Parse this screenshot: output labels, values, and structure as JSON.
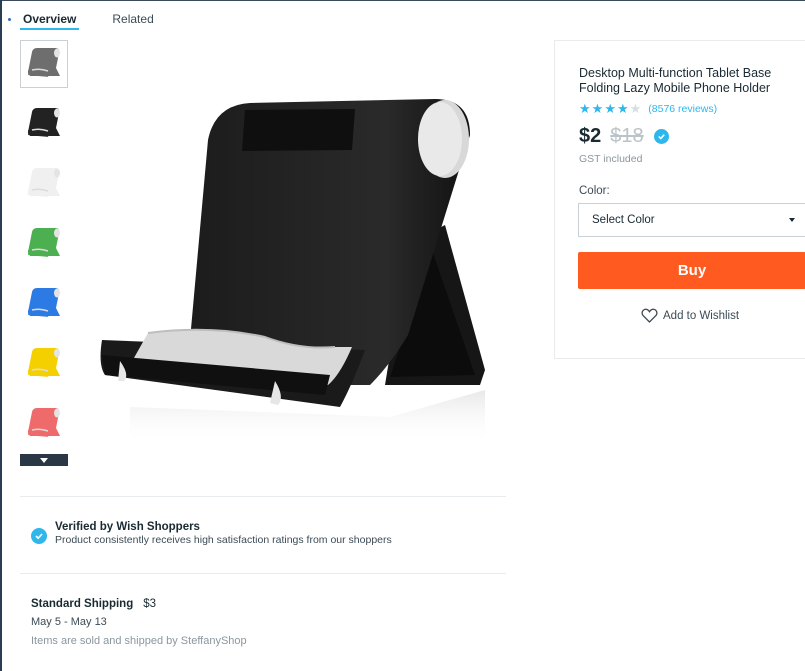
{
  "tabs": {
    "overview": "Overview",
    "related": "Related"
  },
  "thumbnails": [
    {
      "color": "#6e6e6e",
      "icon": "stand-gray-icon"
    },
    {
      "color": "#222222",
      "icon": "stand-black-icon"
    },
    {
      "color": "#f0f0f0",
      "icon": "stand-white-icon"
    },
    {
      "color": "#4caf50",
      "icon": "stand-green-icon"
    },
    {
      "color": "#2c7be5",
      "icon": "stand-blue-icon"
    },
    {
      "color": "#f5d000",
      "icon": "stand-yellow-icon"
    },
    {
      "color": "#ef6a6a",
      "icon": "stand-pink-icon"
    }
  ],
  "verified": {
    "title": "Verified by Wish Shoppers",
    "subtitle": "Product consistently receives high satisfaction ratings from our shoppers"
  },
  "shipping": {
    "title": "Standard Shipping",
    "price": "$3",
    "dates": "May 5 - May 13",
    "seller": "Items are sold and shipped by SteffanyShop"
  },
  "product": {
    "title": "Desktop Multi-function Tablet Base Folding Lazy Mobile Phone Holder",
    "rating": 4,
    "rating_max": 5,
    "reviews": "(8576 reviews)",
    "price": "$2",
    "original_price": "$18",
    "gst": "GST included",
    "color_label": "Color:",
    "color_select": "Select Color",
    "buy_label": "Buy",
    "wishlist_label": "Add to Wishlist"
  },
  "colors": {
    "accent": "#2fb7ec",
    "buy": "#ff5a1f",
    "text": "#192a32",
    "muted": "#8a979e"
  }
}
